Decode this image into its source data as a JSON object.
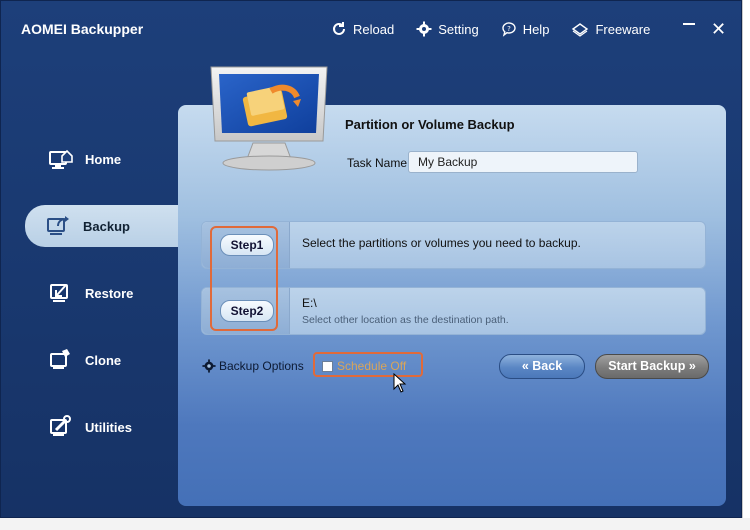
{
  "app": {
    "title": "AOMEI Backupper"
  },
  "top_menu": [
    {
      "label": "Reload",
      "icon": "reload-icon"
    },
    {
      "label": "Setting",
      "icon": "gear-icon"
    },
    {
      "label": "Help",
      "icon": "help-icon"
    },
    {
      "label": "Freeware",
      "icon": "freeware-icon"
    }
  ],
  "window_controls": {
    "close": "✕"
  },
  "sidebar": {
    "items": [
      {
        "label": "Home",
        "icon": "home-icon",
        "active": false
      },
      {
        "label": "Backup",
        "icon": "backup-icon",
        "active": true
      },
      {
        "label": "Restore",
        "icon": "restore-icon",
        "active": false
      },
      {
        "label": "Clone",
        "icon": "clone-icon",
        "active": false
      },
      {
        "label": "Utilities",
        "icon": "utilities-icon",
        "active": false
      }
    ]
  },
  "main": {
    "title": "Partition or Volume Backup",
    "task_name_label": "Task Name",
    "task_name_value": "My Backup",
    "step1": {
      "button": "Step1",
      "text": "Select the partitions or volumes you need to backup."
    },
    "step2": {
      "button": "Step2",
      "path": "E:\\",
      "hint": "Select other location as the destination path."
    },
    "backup_options_label": "Backup Options",
    "schedule_label": "Schedule Off",
    "back_label": "Back",
    "start_label": "Start Backup"
  },
  "colors": {
    "accent_highlight": "#e06a3a",
    "app_background": "#1a3a72",
    "schedule_text": "#d8a55a"
  }
}
